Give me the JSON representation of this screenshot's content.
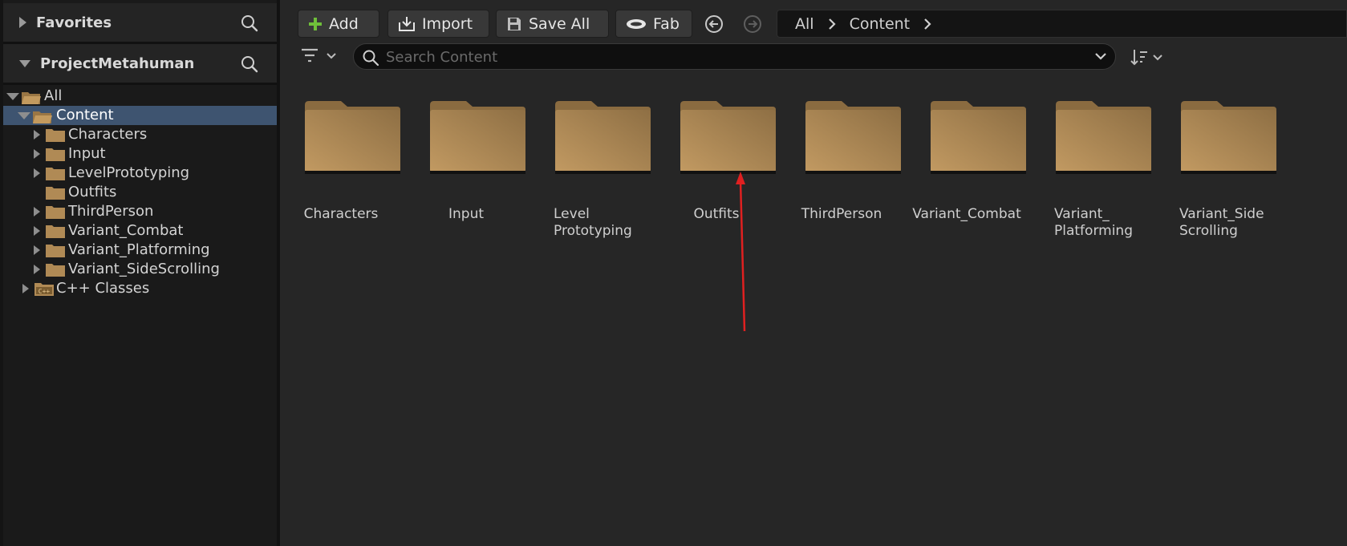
{
  "sidebar": {
    "favorites_label": "Favorites",
    "project_label": "ProjectMetahuman",
    "tree": [
      {
        "label": "All"
      },
      {
        "label": "Content"
      },
      {
        "label": "Characters"
      },
      {
        "label": "Input"
      },
      {
        "label": "LevelPrototyping"
      },
      {
        "label": "Outfits"
      },
      {
        "label": "ThirdPerson"
      },
      {
        "label": "Variant_Combat"
      },
      {
        "label": "Variant_Platforming"
      },
      {
        "label": "Variant_SideScrolling"
      },
      {
        "label": "C++ Classes"
      }
    ]
  },
  "toolbar": {
    "add_label": "Add",
    "import_label": "Import",
    "save_all_label": "Save All",
    "fab_label": "Fab"
  },
  "breadcrumb": {
    "items": [
      "All",
      "Content"
    ]
  },
  "search": {
    "placeholder": "Search Content"
  },
  "grid": {
    "items": [
      {
        "label_lines": [
          "Characters"
        ]
      },
      {
        "label_lines": [
          "Input"
        ]
      },
      {
        "label_lines": [
          "Level",
          "Prototyping"
        ]
      },
      {
        "label_lines": [
          "Outfits"
        ]
      },
      {
        "label_lines": [
          "ThirdPerson"
        ]
      },
      {
        "label_lines": [
          "Variant_Combat"
        ]
      },
      {
        "label_lines": [
          "Variant_",
          "Platforming"
        ]
      },
      {
        "label_lines": [
          "Variant_Side",
          "Scrolling"
        ]
      }
    ]
  },
  "colors": {
    "folder": "#b08a55",
    "selection": "#3e5470",
    "add_icon": "#6fbf3a",
    "annotation_arrow": "#e02020"
  },
  "icons": {
    "search": "magnifier-icon",
    "folder": "folder-icon",
    "filter": "filter-icon",
    "sort": "sort-icon",
    "back": "back-arrow-icon",
    "forward": "forward-arrow-icon"
  }
}
